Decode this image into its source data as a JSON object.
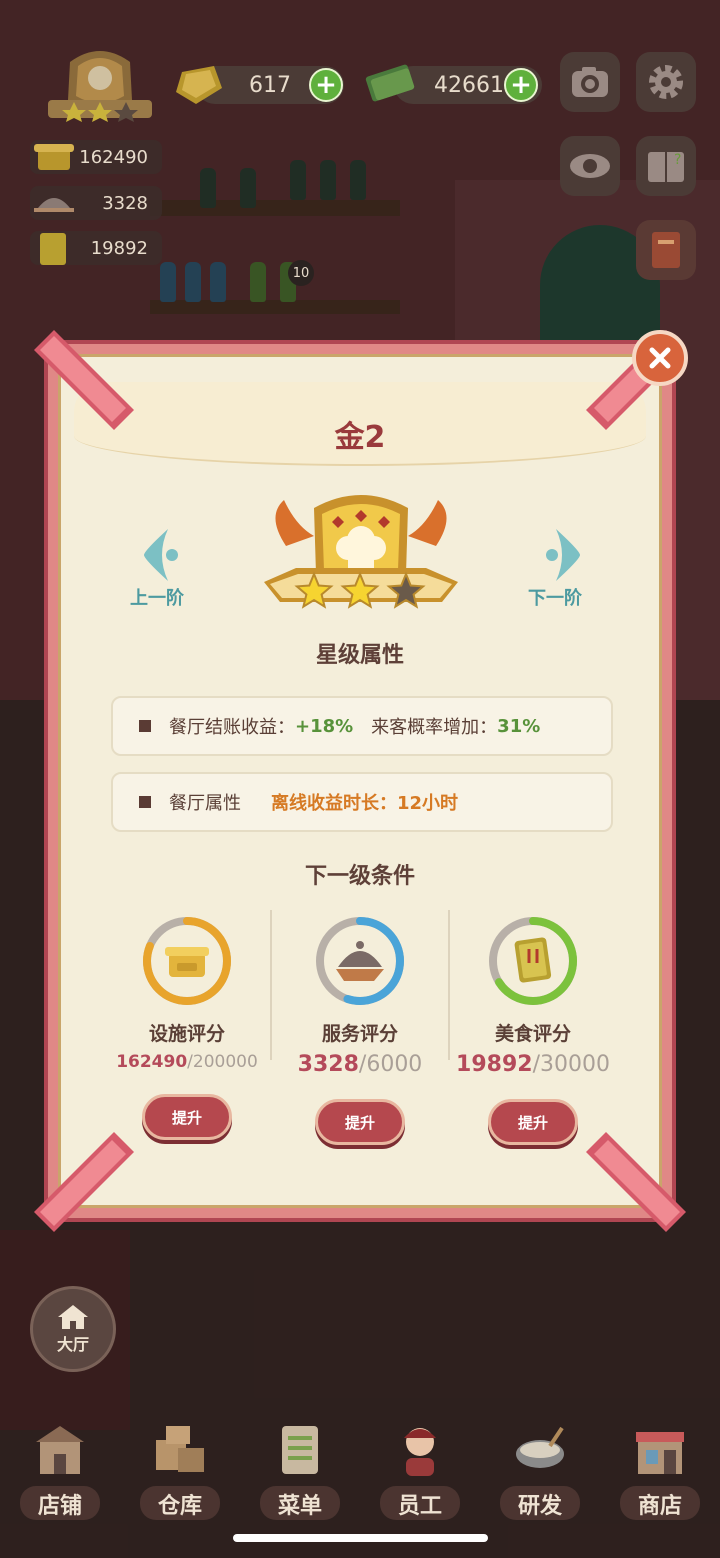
{
  "hud": {
    "gems": "617",
    "cash": "426610",
    "stats": [
      "162490",
      "3328",
      "19892"
    ],
    "stat_badge": "10"
  },
  "modal": {
    "title": "金2",
    "prev_label": "上一阶",
    "next_label": "下一阶",
    "stars_filled": 2,
    "stars_total": 3,
    "section_star_attrs": "星级属性",
    "attr_rows": [
      {
        "label": "餐厅结账收益：",
        "value1": "+18%",
        "label2": "来客概率增加：",
        "value2": "31%"
      },
      {
        "label": "餐厅属性",
        "label2": "离线收益时长：",
        "value2": "12小时"
      }
    ],
    "section_next": "下一级条件",
    "requirements": [
      {
        "name": "设施评分",
        "current": "162490",
        "target": "/200000",
        "progress": 0.81,
        "ring_color": "#e8a42c",
        "button": "提升"
      },
      {
        "name": "服务评分",
        "current": "3328",
        "target": "/6000",
        "progress": 0.55,
        "ring_color": "#4aa4d8",
        "button": "提升"
      },
      {
        "name": "美食评分",
        "current": "19892",
        "target": "/30000",
        "progress": 0.66,
        "ring_color": "#7cc23c",
        "button": "提升"
      }
    ]
  },
  "lobby_label": "大厅",
  "tabs": [
    "店铺",
    "仓库",
    "菜单",
    "员工",
    "研发",
    "商店"
  ]
}
